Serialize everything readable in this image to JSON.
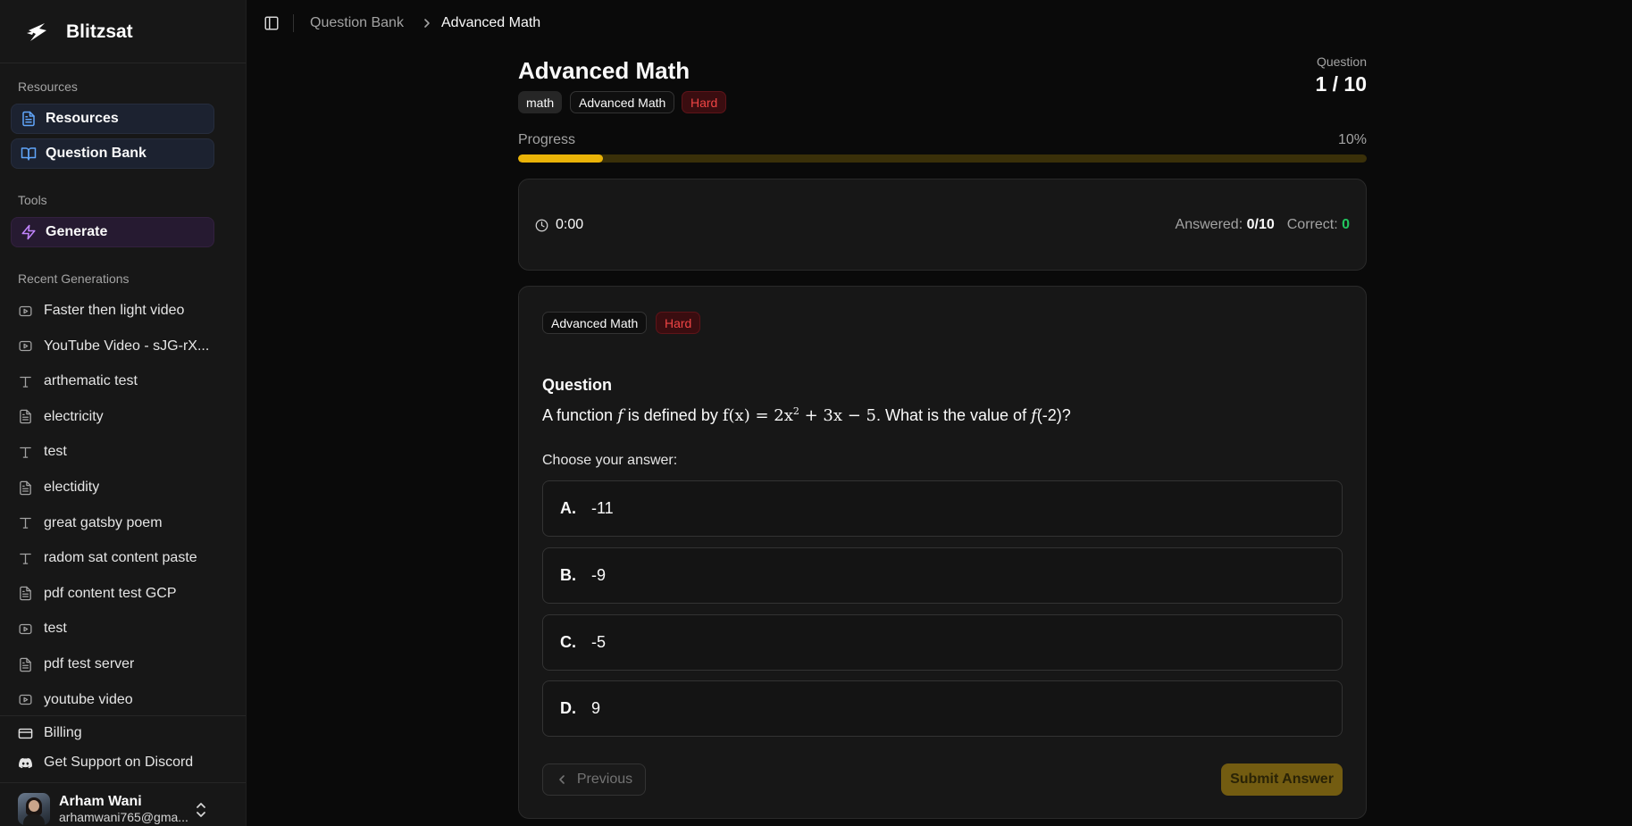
{
  "app": {
    "name": "Blitzsat",
    "logo_icon": "lightning-logo-icon"
  },
  "sidebar": {
    "resources_section": "Resources",
    "resources_items": [
      {
        "label": "Resources",
        "icon": "file-text-icon"
      },
      {
        "label": "Question Bank",
        "icon": "book-open-icon"
      }
    ],
    "tools_section": "Tools",
    "tools_items": [
      {
        "label": "Generate",
        "icon": "lightning-icon"
      }
    ],
    "recent_section": "Recent Generations",
    "recent": [
      {
        "label": "Faster then light video",
        "icon": "video-icon"
      },
      {
        "label": "YouTube Video - sJG-rX...",
        "icon": "video-icon"
      },
      {
        "label": "arthematic test",
        "icon": "text-icon"
      },
      {
        "label": "electricity",
        "icon": "file-text-icon"
      },
      {
        "label": "test",
        "icon": "text-icon"
      },
      {
        "label": "electidity",
        "icon": "file-text-icon"
      },
      {
        "label": "great gatsby poem",
        "icon": "text-icon"
      },
      {
        "label": "radom sat content paste",
        "icon": "text-icon"
      },
      {
        "label": "pdf content test GCP",
        "icon": "file-text-icon"
      },
      {
        "label": "test",
        "icon": "video-icon"
      },
      {
        "label": "pdf test server",
        "icon": "file-text-icon"
      },
      {
        "label": "youtube video",
        "icon": "video-icon"
      }
    ],
    "footer": {
      "billing": "Billing",
      "support": "Get Support on Discord"
    },
    "user": {
      "name": "Arham Wani",
      "email": "arhamwani765@gma..."
    }
  },
  "breadcrumb": {
    "root": "Question Bank",
    "current": "Advanced Math"
  },
  "header": {
    "title": "Advanced Math",
    "tags": [
      "math",
      "Advanced Math",
      "Hard"
    ],
    "question_label": "Question",
    "question_count": "1 / 10"
  },
  "progress": {
    "label": "Progress",
    "percent_text": "10%",
    "value": 0.1
  },
  "stats": {
    "timer": "0:00",
    "answered_label": "Answered:",
    "answered_value": "0/10",
    "correct_label": "Correct:",
    "correct_value": "0"
  },
  "question": {
    "tags": [
      "Advanced Math",
      "Hard"
    ],
    "heading": "Question",
    "text_prefix": "A function",
    "text_f": "f",
    "text_mid": "is defined by",
    "formula_lhs": "f(x) = 2x",
    "formula_exp": "2",
    "formula_rhs": "+ 3x − 5",
    "text_after": ". What is the value of",
    "text_f2": "f",
    "text_end": "(-2)?",
    "choose_label": "Choose your answer:",
    "options": [
      {
        "letter": "A.",
        "value": "-11"
      },
      {
        "letter": "B.",
        "value": "-9"
      },
      {
        "letter": "C.",
        "value": "-5"
      },
      {
        "letter": "D.",
        "value": "9"
      }
    ]
  },
  "actions": {
    "previous": "Previous",
    "submit": "Submit Answer"
  },
  "colors": {
    "accent_yellow": "#eab308",
    "hard_red": "#ef4444",
    "correct_green": "#22c55e",
    "resources_blue": "#60a5fa",
    "generate_purple": "#c084fc"
  }
}
